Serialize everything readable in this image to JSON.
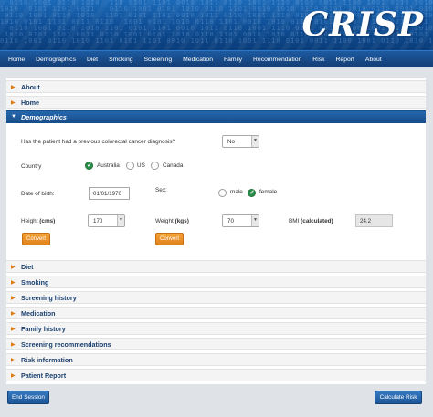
{
  "app": {
    "logo": "CRISP"
  },
  "nav": [
    "Home",
    "Demographics",
    "Diet",
    "Smoking",
    "Screening",
    "Medication",
    "Family",
    "Recommendation",
    "Risk",
    "Report",
    "About"
  ],
  "sections_top": [
    "About",
    "Home"
  ],
  "open_section": "Demographics",
  "sections_bottom": [
    "Diet",
    "Smoking",
    "Screening history",
    "Medication",
    "Family history",
    "Screening recommendations",
    "Risk information",
    "Patient Report"
  ],
  "demographics": {
    "prev_diagnosis_question": "Has the patient had a previous colorectal cancer diagnosis?",
    "prev_diagnosis_value": "No",
    "country_label": "Country",
    "countries": [
      "Australia",
      "US",
      "Canada"
    ],
    "country_selected": "Australia",
    "dob_label": "Date of birth:",
    "dob_value": "01/01/1970",
    "sex_label": "Sex:",
    "sex_options": [
      "male",
      "female"
    ],
    "sex_selected": "female",
    "height_label": "Height",
    "height_unit": "(cms)",
    "height_value": "170",
    "weight_label": "Weight",
    "weight_unit": "(kgs)",
    "weight_value": "70",
    "bmi_label": "BMI",
    "bmi_unit": "(calculated)",
    "bmi_value": "24.2",
    "convert_label": "Convert"
  },
  "footer": {
    "end_session": "End Session",
    "calculate_risk": "Calculate Risk"
  },
  "colors": {
    "accent": "#1d5697",
    "orange": "#e0821c",
    "check_green": "#2a8f4a"
  }
}
